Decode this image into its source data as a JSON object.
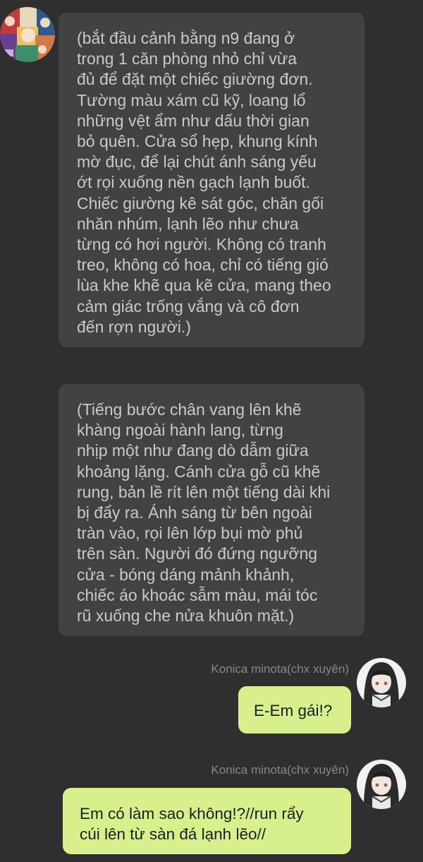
{
  "chat": {
    "messages": [
      {
        "side": "left",
        "avatar_icon": "anime-collage-avatar-icon",
        "text": "(bắt đầu cảnh bằng n9 đang ở\ntrong 1 căn phòng nhỏ chỉ vừa\nđủ để đặt một chiếc giường đơn.\nTường màu xám cũ kỹ, loang lổ\nnhững vệt ẩm như dấu thời gian\nbỏ quên. Cửa sổ hẹp, khung kính\nmờ đục, để lại chút ánh sáng yếu\nớt rọi xuống nền gạch lạnh buốt.\nChiếc giường kê sát góc, chăn gối\nnhăn nhúm, lạnh lẽo như chưa\ntừng có hơi người. Không có tranh\ntreo, không có hoa, chỉ có tiếng gió\nlùa khe khẽ qua kẽ cửa, mang theo\ncảm giác trống vắng và cô đơn\nđến rợn người.)"
      },
      {
        "side": "left",
        "text": "(Tiếng bước chân vang lên khẽ\nkhàng ngoài hành lang, từng\nnhịp một như đang dò dẫm giữa\nkhoảng lặng. Cánh cửa gỗ cũ khẽ\nrung, bản lề rít lên một tiếng dài khi\nbị đẩy ra. Ánh sáng từ bên ngoài\ntràn vào, rọi lên lớp bụi mờ phủ\ntrên sàn. Người đó đứng ngưỡng\ncửa - bóng dáng mảnh khảnh,\nchiếc áo khoác sẫm màu, mái tóc\nrũ xuống che nửa khuôn mặt.)"
      },
      {
        "side": "right",
        "sender": "Konica minota(chx xuyên)",
        "avatar_icon": "dark-hair-girl-avatar-icon",
        "text": "E-Em gái!?"
      },
      {
        "side": "right",
        "sender": "Konica minota(chx xuyên)",
        "avatar_icon": "dark-hair-girl-avatar-icon",
        "text": "Em có làm sao không!?//run rẩy\ncúi lên từ sàn đá lạnh lẽo//"
      }
    ]
  },
  "colors": {
    "background": "#2f2f2f",
    "left_bubble": "#424242",
    "left_text": "#c9c9c9",
    "right_bubble": "#d8f08c",
    "right_text": "#1d1d1d",
    "sender_name": "#888888"
  }
}
